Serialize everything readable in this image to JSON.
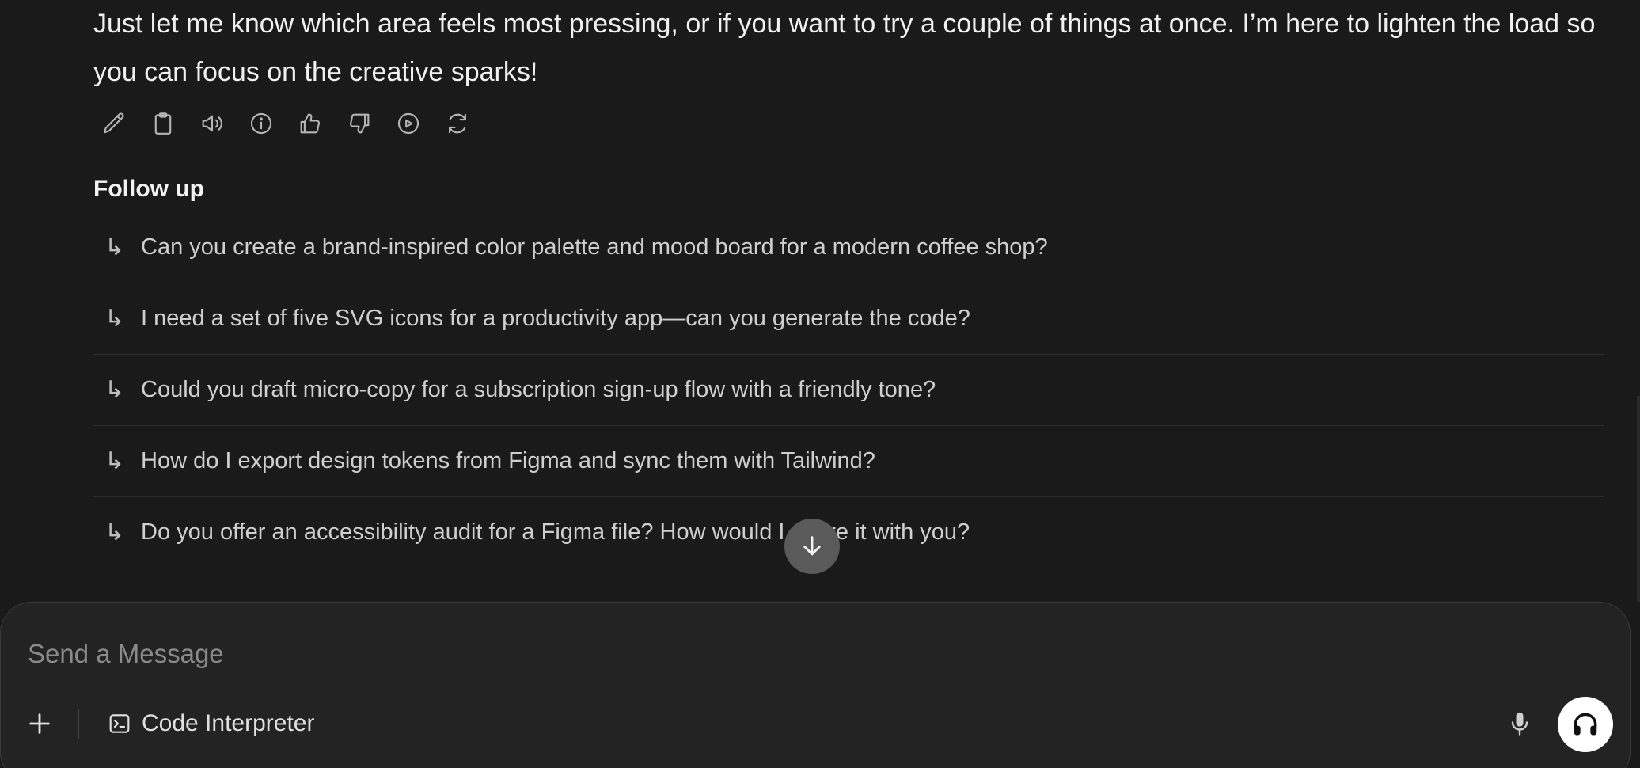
{
  "message": {
    "text": "Just let me know which area feels most pressing, or if you want to try a couple of things at once. I’m here to lighten the load so you can focus on the creative sparks!"
  },
  "actions": [
    {
      "icon": "pencil-icon",
      "name": "edit-button"
    },
    {
      "icon": "clipboard-icon",
      "name": "copy-button"
    },
    {
      "icon": "speaker-icon",
      "name": "read-aloud-button"
    },
    {
      "icon": "info-icon",
      "name": "info-button"
    },
    {
      "icon": "thumbs-up-icon",
      "name": "good-response-button"
    },
    {
      "icon": "thumbs-down-icon",
      "name": "bad-response-button"
    },
    {
      "icon": "play-circle-icon",
      "name": "continue-button"
    },
    {
      "icon": "refresh-icon",
      "name": "regenerate-button"
    }
  ],
  "followup": {
    "title": "Follow up",
    "arrow": "↳",
    "items": [
      "Can you create a brand-inspired color palette and mood board for a modern coffee shop?",
      "I need a set of five SVG icons for a productivity app—can you generate the code?",
      "Could you draft micro-copy for a subscription sign-up flow with a friendly tone?",
      "How do I export design tokens from Figma and sync them with Tailwind?",
      "Do you offer an accessibility audit for a Figma file? How would I share it with you?"
    ]
  },
  "scroll_button": {
    "icon": "arrow-down-icon"
  },
  "composer": {
    "placeholder": "Send a Message",
    "value": "",
    "plus_icon": "plus-icon",
    "code_interpreter_label": "Code Interpreter",
    "code_interpreter_icon": "terminal-icon",
    "mic_icon": "microphone-icon",
    "call_icon": "headphones-icon"
  },
  "colors": {
    "background": "#1a1a1a",
    "composer_bg": "#232323",
    "text": "#ececec",
    "muted": "#8a8a8a"
  }
}
